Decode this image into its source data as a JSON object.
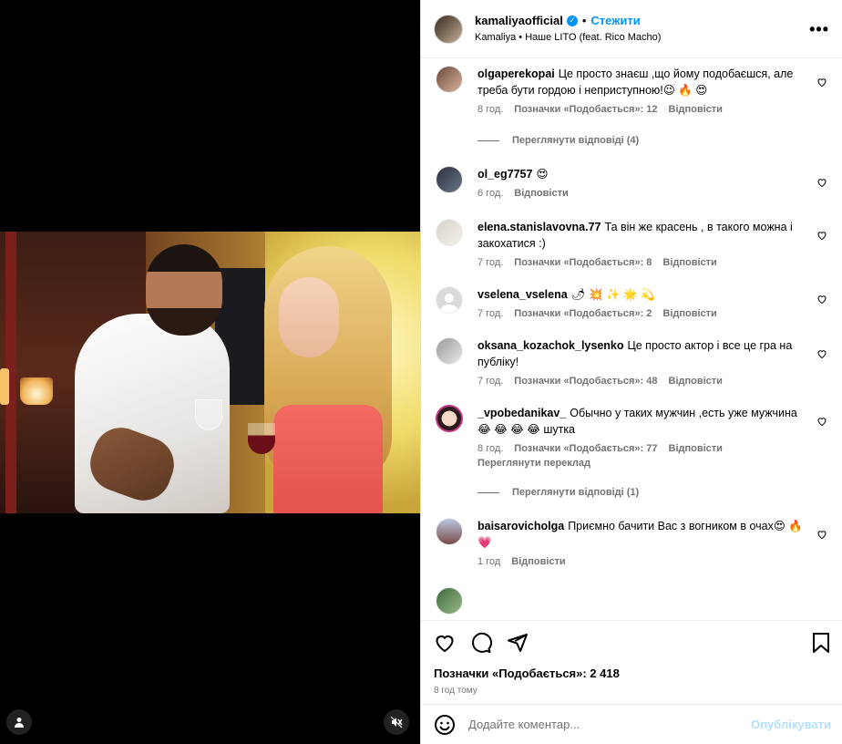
{
  "header": {
    "username": "kamaliyaofficial",
    "verified_mark": "✓",
    "separator": "•",
    "follow_label": "Стежити",
    "audio_line": "Kamaliya • Наше LITO (feat. Rico Macho)",
    "more_label": "•••"
  },
  "comments": [
    {
      "username": "olgaperekopai",
      "text": "Це просто знаєш ,що йому подобаєшся, але треба бути гордою і неприступною!😉 🔥 😍",
      "time": "8 год.",
      "likes": "Позначки «Подобається»: 12",
      "reply": "Відповісти",
      "view_replies": "Переглянути відповіді (4)"
    },
    {
      "username": "ol_eg7757",
      "text": "😍",
      "time": "6 год.",
      "reply": "Відповісти"
    },
    {
      "username": "elena.stanislavovna.77",
      "text": "Та він же красень , в такого можна і закохатися :)",
      "time": "7 год.",
      "likes": "Позначки «Подобається»: 8",
      "reply": "Відповісти"
    },
    {
      "username": "vselena_vselena",
      "text": "🌶 💥 ✨ 🌟 💫",
      "time": "7 год.",
      "likes": "Позначки «Подобається»: 2",
      "reply": "Відповісти"
    },
    {
      "username": "oksana_kozachok_lysenko",
      "text": "Це просто актор і все це гра на публіку!",
      "time": "7 год.",
      "likes": "Позначки «Подобається»: 48",
      "reply": "Відповісти"
    },
    {
      "username": "_vpobedanikav_",
      "text": "Обычно у таких мужчин ,есть уже мужчина 😂 😂 😂 😂 шутка",
      "time": "8 год.",
      "likes": "Позначки «Подобається»: 77",
      "reply": "Відповісти",
      "translate": "Переглянути переклад",
      "view_replies": "Переглянути відповіді (1)"
    },
    {
      "username": "baisarovicholga",
      "text": "Приємно бачити Вас з вогником в очах😍 🔥 💗",
      "time": "1 год",
      "reply": "Відповісти"
    }
  ],
  "footer": {
    "likes_summary": "Позначки «Подобається»: 2 418",
    "time_ago": "8 год тому",
    "comment_placeholder": "Додайте коментар...",
    "publish_label": "Опублікувати"
  },
  "icons": {
    "heart": "heart-icon",
    "comment": "comment-icon",
    "share": "share-icon",
    "save": "bookmark-icon",
    "emoji": "emoji-icon",
    "user_tag": "user-icon",
    "mute": "muted-speaker-icon"
  },
  "colors": {
    "accent": "#0095f6",
    "publish_disabled": "#b2dffc",
    "meta": "#737373"
  }
}
